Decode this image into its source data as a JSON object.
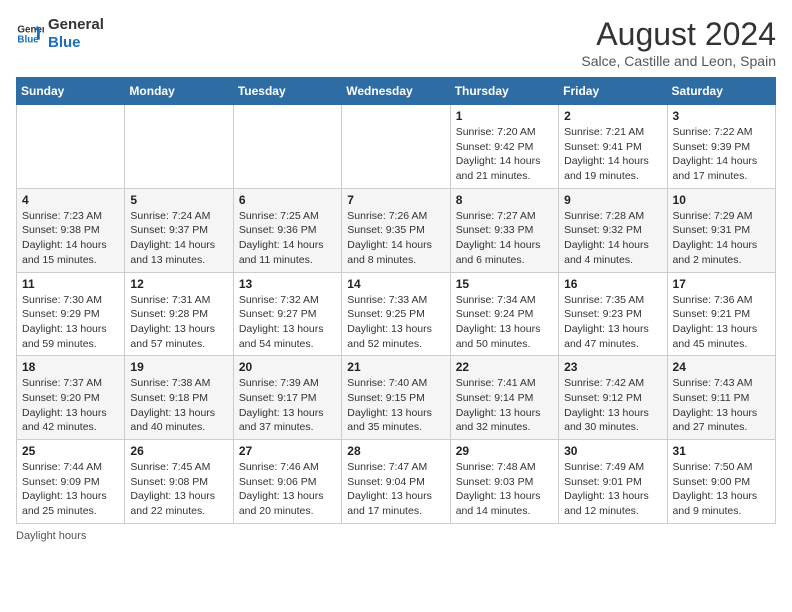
{
  "header": {
    "logo_line1": "General",
    "logo_line2": "Blue",
    "month_year": "August 2024",
    "location": "Salce, Castille and Leon, Spain"
  },
  "weekdays": [
    "Sunday",
    "Monday",
    "Tuesday",
    "Wednesday",
    "Thursday",
    "Friday",
    "Saturday"
  ],
  "weeks": [
    [
      {
        "day": "",
        "info": ""
      },
      {
        "day": "",
        "info": ""
      },
      {
        "day": "",
        "info": ""
      },
      {
        "day": "",
        "info": ""
      },
      {
        "day": "1",
        "info": "Sunrise: 7:20 AM\nSunset: 9:42 PM\nDaylight: 14 hours\nand 21 minutes."
      },
      {
        "day": "2",
        "info": "Sunrise: 7:21 AM\nSunset: 9:41 PM\nDaylight: 14 hours\nand 19 minutes."
      },
      {
        "day": "3",
        "info": "Sunrise: 7:22 AM\nSunset: 9:39 PM\nDaylight: 14 hours\nand 17 minutes."
      }
    ],
    [
      {
        "day": "4",
        "info": "Sunrise: 7:23 AM\nSunset: 9:38 PM\nDaylight: 14 hours\nand 15 minutes."
      },
      {
        "day": "5",
        "info": "Sunrise: 7:24 AM\nSunset: 9:37 PM\nDaylight: 14 hours\nand 13 minutes."
      },
      {
        "day": "6",
        "info": "Sunrise: 7:25 AM\nSunset: 9:36 PM\nDaylight: 14 hours\nand 11 minutes."
      },
      {
        "day": "7",
        "info": "Sunrise: 7:26 AM\nSunset: 9:35 PM\nDaylight: 14 hours\nand 8 minutes."
      },
      {
        "day": "8",
        "info": "Sunrise: 7:27 AM\nSunset: 9:33 PM\nDaylight: 14 hours\nand 6 minutes."
      },
      {
        "day": "9",
        "info": "Sunrise: 7:28 AM\nSunset: 9:32 PM\nDaylight: 14 hours\nand 4 minutes."
      },
      {
        "day": "10",
        "info": "Sunrise: 7:29 AM\nSunset: 9:31 PM\nDaylight: 14 hours\nand 2 minutes."
      }
    ],
    [
      {
        "day": "11",
        "info": "Sunrise: 7:30 AM\nSunset: 9:29 PM\nDaylight: 13 hours\nand 59 minutes."
      },
      {
        "day": "12",
        "info": "Sunrise: 7:31 AM\nSunset: 9:28 PM\nDaylight: 13 hours\nand 57 minutes."
      },
      {
        "day": "13",
        "info": "Sunrise: 7:32 AM\nSunset: 9:27 PM\nDaylight: 13 hours\nand 54 minutes."
      },
      {
        "day": "14",
        "info": "Sunrise: 7:33 AM\nSunset: 9:25 PM\nDaylight: 13 hours\nand 52 minutes."
      },
      {
        "day": "15",
        "info": "Sunrise: 7:34 AM\nSunset: 9:24 PM\nDaylight: 13 hours\nand 50 minutes."
      },
      {
        "day": "16",
        "info": "Sunrise: 7:35 AM\nSunset: 9:23 PM\nDaylight: 13 hours\nand 47 minutes."
      },
      {
        "day": "17",
        "info": "Sunrise: 7:36 AM\nSunset: 9:21 PM\nDaylight: 13 hours\nand 45 minutes."
      }
    ],
    [
      {
        "day": "18",
        "info": "Sunrise: 7:37 AM\nSunset: 9:20 PM\nDaylight: 13 hours\nand 42 minutes."
      },
      {
        "day": "19",
        "info": "Sunrise: 7:38 AM\nSunset: 9:18 PM\nDaylight: 13 hours\nand 40 minutes."
      },
      {
        "day": "20",
        "info": "Sunrise: 7:39 AM\nSunset: 9:17 PM\nDaylight: 13 hours\nand 37 minutes."
      },
      {
        "day": "21",
        "info": "Sunrise: 7:40 AM\nSunset: 9:15 PM\nDaylight: 13 hours\nand 35 minutes."
      },
      {
        "day": "22",
        "info": "Sunrise: 7:41 AM\nSunset: 9:14 PM\nDaylight: 13 hours\nand 32 minutes."
      },
      {
        "day": "23",
        "info": "Sunrise: 7:42 AM\nSunset: 9:12 PM\nDaylight: 13 hours\nand 30 minutes."
      },
      {
        "day": "24",
        "info": "Sunrise: 7:43 AM\nSunset: 9:11 PM\nDaylight: 13 hours\nand 27 minutes."
      }
    ],
    [
      {
        "day": "25",
        "info": "Sunrise: 7:44 AM\nSunset: 9:09 PM\nDaylight: 13 hours\nand 25 minutes."
      },
      {
        "day": "26",
        "info": "Sunrise: 7:45 AM\nSunset: 9:08 PM\nDaylight: 13 hours\nand 22 minutes."
      },
      {
        "day": "27",
        "info": "Sunrise: 7:46 AM\nSunset: 9:06 PM\nDaylight: 13 hours\nand 20 minutes."
      },
      {
        "day": "28",
        "info": "Sunrise: 7:47 AM\nSunset: 9:04 PM\nDaylight: 13 hours\nand 17 minutes."
      },
      {
        "day": "29",
        "info": "Sunrise: 7:48 AM\nSunset: 9:03 PM\nDaylight: 13 hours\nand 14 minutes."
      },
      {
        "day": "30",
        "info": "Sunrise: 7:49 AM\nSunset: 9:01 PM\nDaylight: 13 hours\nand 12 minutes."
      },
      {
        "day": "31",
        "info": "Sunrise: 7:50 AM\nSunset: 9:00 PM\nDaylight: 13 hours\nand 9 minutes."
      }
    ]
  ],
  "footer": {
    "note": "Daylight hours"
  }
}
